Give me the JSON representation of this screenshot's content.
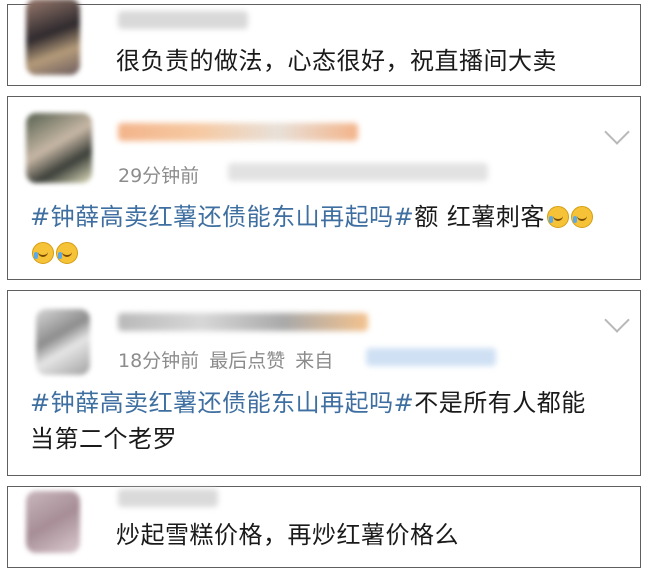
{
  "comments": [
    {
      "text": "很负责的做法，心态很好，祝直播间大卖"
    },
    {
      "time": "29分钟前",
      "hashtag": "#钟薛高卖红薯还债能东山再起吗#",
      "text": "额 红薯刺客",
      "emoji": "crying-laughing-emoji"
    },
    {
      "time": "18分钟前",
      "liked": "最后点赞",
      "source": "来自",
      "hashtag": "#钟薛高卖红薯还债能东山再起吗#",
      "text_line1": "不是所有人都能",
      "text_line2": "当第二个老罗"
    },
    {
      "text": "炒起雪糕价格，再炒红薯价格么"
    }
  ],
  "colors": {
    "hashtag": "#3f6fa0",
    "meta": "#8c8c8c",
    "border": "#5f5f5f"
  },
  "icons": {
    "expand": "chevron-down-icon"
  }
}
